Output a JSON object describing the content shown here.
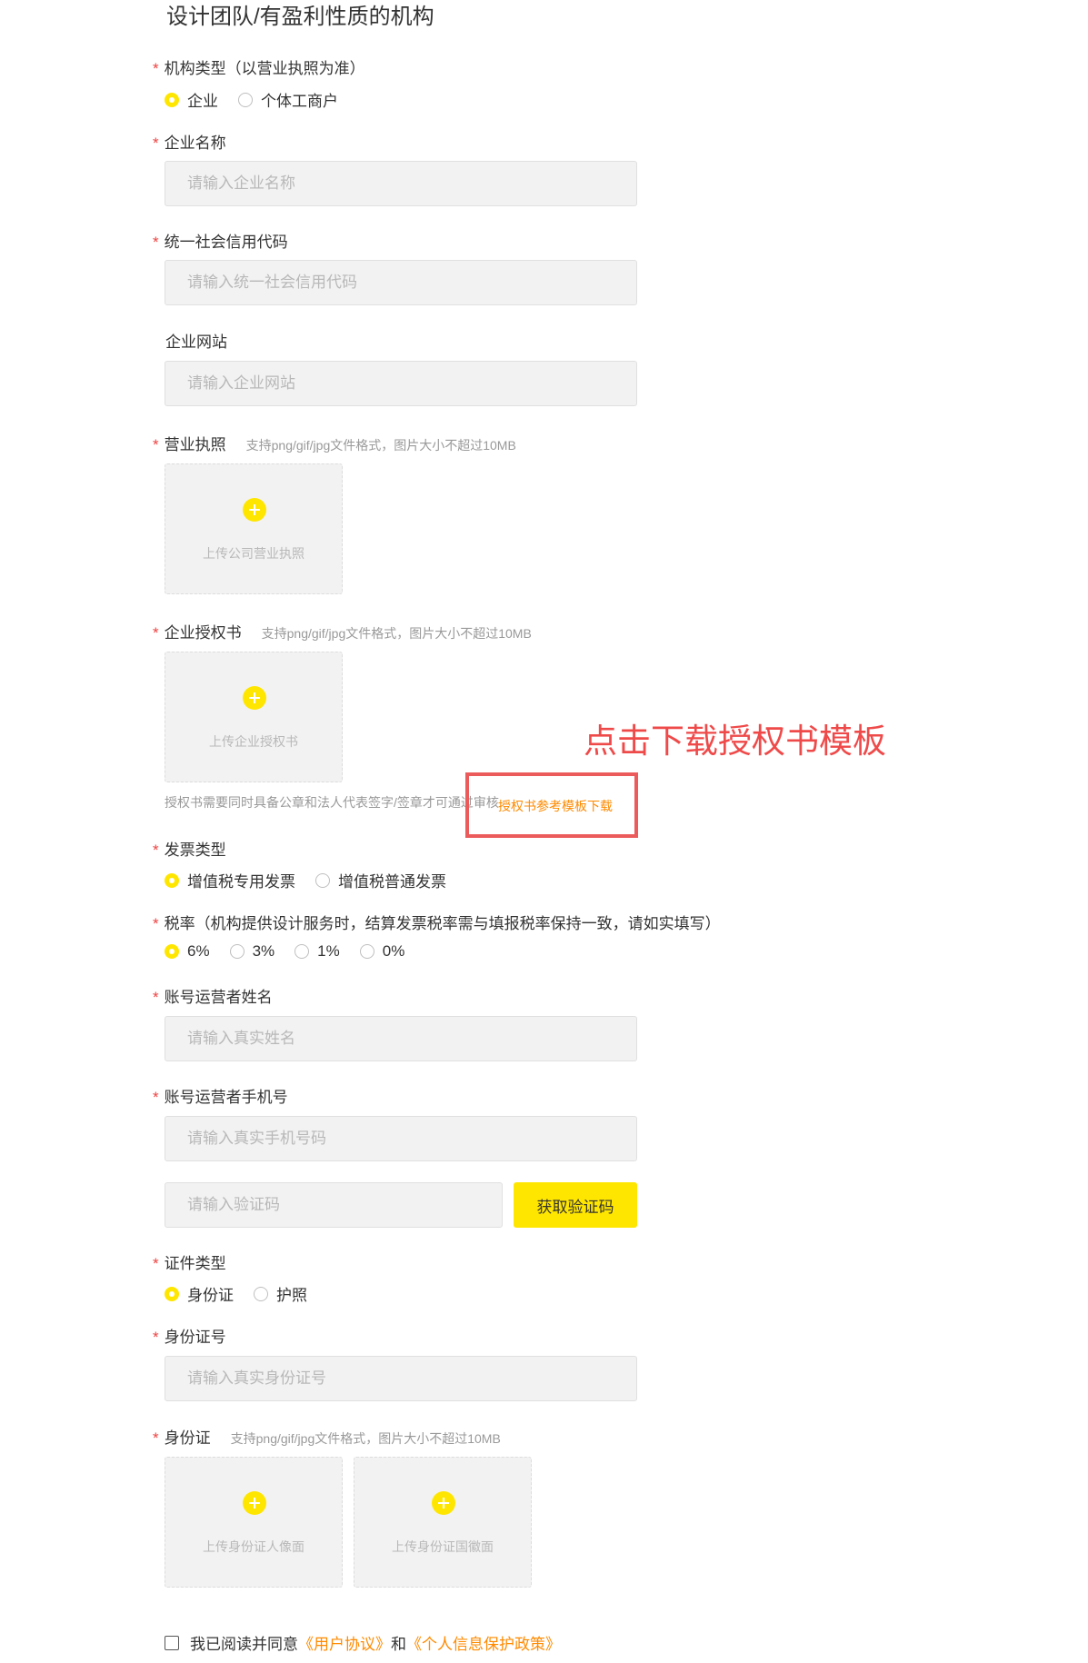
{
  "page_title": "设计团队/有盈利性质的机构",
  "org_type": {
    "label": "机构类型（以营业执照为准）",
    "options": [
      "企业",
      "个体工商户"
    ],
    "selected": "企业"
  },
  "company_name": {
    "label": "企业名称",
    "placeholder": "请输入企业名称"
  },
  "credit_code": {
    "label": "统一社会信用代码",
    "placeholder": "请输入统一社会信用代码"
  },
  "website": {
    "label": "企业网站",
    "placeholder": "请输入企业网站"
  },
  "business_license": {
    "label": "营业执照",
    "hint": "支持png/gif/jpg文件格式，图片大小不超过10MB",
    "upload_label": "上传公司营业执照"
  },
  "authorization": {
    "label": "企业授权书",
    "hint": "支持png/gif/jpg文件格式，图片大小不超过10MB",
    "upload_label": "上传企业授权书",
    "note": "授权书需要同时具备公章和法人代表签字/签章才可通过审核",
    "template_link": "授权书参考模板下载"
  },
  "annotation": "点击下载授权书模板",
  "invoice_type": {
    "label": "发票类型",
    "options": [
      "增值税专用发票",
      "增值税普通发票"
    ],
    "selected": "增值税专用发票"
  },
  "tax_rate": {
    "label": "税率（机构提供设计服务时，结算发票税率需与填报税率保持一致，请如实填写）",
    "options": [
      "6%",
      "3%",
      "1%",
      "0%"
    ],
    "selected": "6%"
  },
  "operator_name": {
    "label": "账号运营者姓名",
    "placeholder": "请输入真实姓名"
  },
  "operator_phone": {
    "label": "账号运营者手机号",
    "placeholder": "请输入真实手机号码",
    "code_placeholder": "请输入验证码",
    "code_button": "获取验证码"
  },
  "id_type": {
    "label": "证件类型",
    "options": [
      "身份证",
      "护照"
    ],
    "selected": "身份证"
  },
  "id_number": {
    "label": "身份证号",
    "placeholder": "请输入真实身份证号"
  },
  "id_card": {
    "label": "身份证",
    "hint": "支持png/gif/jpg文件格式，图片大小不超过10MB",
    "front_label": "上传身份证人像面",
    "back_label": "上传身份证国徽面"
  },
  "agreement": {
    "prefix": "我已阅读并同意",
    "user_agreement": "《用户协议》",
    "conjunction": "和",
    "privacy_policy": "《个人信息保护政策》"
  },
  "colors": {
    "accent": "#ffe600",
    "required_star": "#f04141",
    "link": "#ff8a00",
    "annotation": "#ef4a4a"
  },
  "icons": [
    "plus-icon"
  ]
}
